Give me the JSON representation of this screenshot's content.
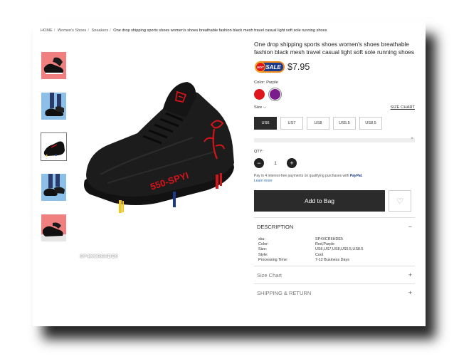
{
  "breadcrumb": {
    "items": [
      "HOME",
      "Women's Shoes",
      "Sneakers"
    ],
    "current": "One drop shipping sports shoes women's shoes breathable fashion black mesh travel casual light soft sole running shoes",
    "separator": "/"
  },
  "product": {
    "title": "One drop shipping sports shoes women's shoes breathable fashion black mesh travel casual light soft sole running shoes",
    "badge_hot": "HOT",
    "badge_sale": "SALE",
    "price": "$7.95",
    "watermark": "SP4XCR6HDE5",
    "shoe_text": "550-SPYI"
  },
  "color": {
    "label": "Color: Purple",
    "swatches": [
      {
        "name": "Red",
        "hex": "#e0141b"
      },
      {
        "name": "Purple",
        "hex": "#7a1c8c"
      }
    ]
  },
  "size": {
    "label": "Size",
    "chart_link": "SIZE CHART",
    "options": [
      "US6",
      "US7",
      "US8",
      "US5.5",
      "US8.5"
    ],
    "selected": "US6"
  },
  "quantity": {
    "label": "QTY:",
    "value": "1",
    "minus": "−",
    "plus": "+"
  },
  "paypal": {
    "text": "Pay in 4 interest-free payments on qualifying purchases with",
    "brand": "PayPal.",
    "learn_more": "Learn more"
  },
  "actions": {
    "add_to_bag": "Add to Bag"
  },
  "description": {
    "heading": "DESCRIPTION",
    "sign": "−",
    "specs": [
      {
        "key": "sku:",
        "value": "SP4XCR6HDE5"
      },
      {
        "key": "Color:",
        "value": "Red,Purple"
      },
      {
        "key": "Size:",
        "value": "US6,US7,US8,US5.5,US8.5"
      },
      {
        "key": "Style:",
        "value": "Cool"
      },
      {
        "key": "Processing Time:",
        "value": "7-12 Business Days"
      }
    ]
  },
  "sections": [
    {
      "label": "Size Chart",
      "sign": "+"
    },
    {
      "label": "SHIPPING & RETURN",
      "sign": "+"
    }
  ],
  "colors": {
    "accent_dark": "#2b2b2b",
    "sale_orange": "#f08a1c",
    "sale_blue": "#1b3a8c",
    "hot_red": "#e0141b"
  }
}
